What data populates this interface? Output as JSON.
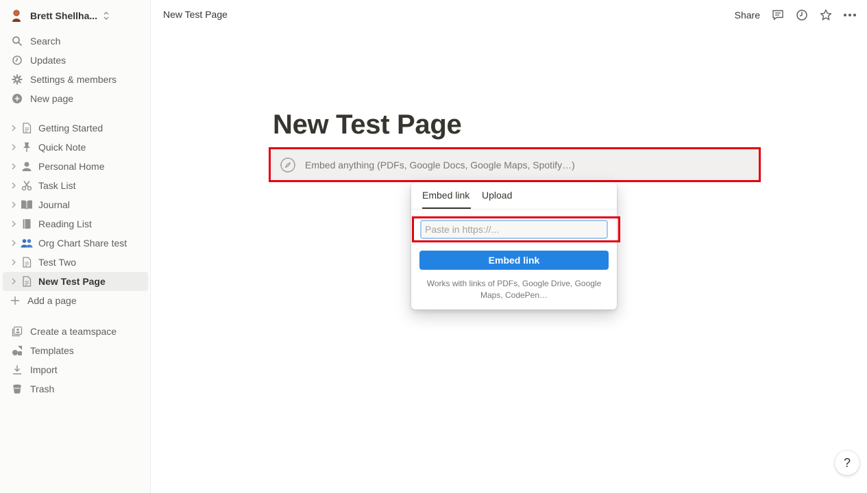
{
  "workspace": {
    "name": "Brett Shellha..."
  },
  "sidebar": {
    "top_items": [
      {
        "label": "Search",
        "icon": "search-icon"
      },
      {
        "label": "Updates",
        "icon": "clock-icon"
      },
      {
        "label": "Settings & members",
        "icon": "gear-icon"
      },
      {
        "label": "New page",
        "icon": "plus-circle-icon"
      }
    ],
    "pages": [
      {
        "label": "Getting Started",
        "icon": "page-icon"
      },
      {
        "label": "Quick Note",
        "icon": "pin-icon"
      },
      {
        "label": "Personal Home",
        "icon": "person-icon"
      },
      {
        "label": "Task List",
        "icon": "scissors-icon"
      },
      {
        "label": "Journal",
        "icon": "book-icon"
      },
      {
        "label": "Reading List",
        "icon": "notebook-icon"
      },
      {
        "label": "Org Chart Share test",
        "icon": "people-emoji",
        "glyph": "👥"
      },
      {
        "label": "Test Two",
        "icon": "page-icon"
      },
      {
        "label": "New Test Page",
        "icon": "page-icon",
        "active": true
      }
    ],
    "add_page": "Add a page",
    "bottom_items": [
      {
        "label": "Create a teamspace",
        "icon": "teamspace-icon"
      },
      {
        "label": "Templates",
        "icon": "templates-icon"
      },
      {
        "label": "Import",
        "icon": "import-icon"
      },
      {
        "label": "Trash",
        "icon": "trash-icon"
      }
    ]
  },
  "topbar": {
    "breadcrumb": "New Test Page",
    "share_label": "Share"
  },
  "main": {
    "title": "New Test Page",
    "embed_placeholder": "Embed anything (PDFs, Google Docs, Google Maps, Spotify…)"
  },
  "popover": {
    "tabs": [
      "Embed link",
      "Upload"
    ],
    "active_tab": "Embed link",
    "input_placeholder": "Paste in https://...",
    "input_value": "",
    "button_label": "Embed link",
    "hint": "Works with links of PDFs, Google Drive, Google Maps, CodePen…"
  },
  "help_label": "?",
  "colors": {
    "accent": "#2383e2",
    "highlight": "#e3000f",
    "sidebar_bg": "#fbfbfa",
    "embed_bg": "#f1f0ef"
  }
}
